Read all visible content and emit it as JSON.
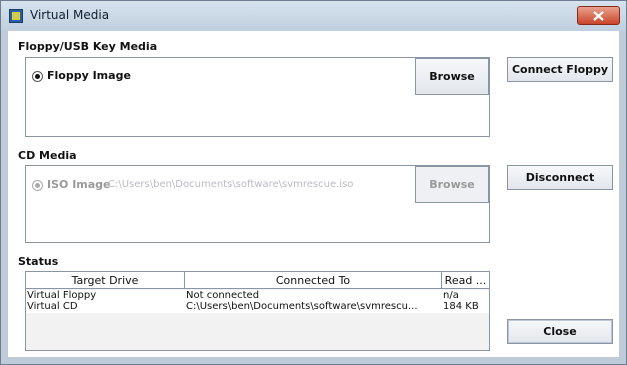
{
  "window": {
    "title": "Virtual Media"
  },
  "floppy": {
    "section_label": "Floppy/USB Key Media",
    "radio_label": "Floppy Image",
    "browse_label": "Browse",
    "connect_label": "Connect Floppy"
  },
  "cd": {
    "section_label": "CD Media",
    "radio_label": "ISO Image",
    "path": "C:\\Users\\ben\\Documents\\software\\svmrescue.iso",
    "browse_label": "Browse",
    "disconnect_label": "Disconnect"
  },
  "status": {
    "section_label": "Status",
    "columns": [
      "Target Drive",
      "Connected To",
      "Read ..."
    ],
    "rows": [
      [
        "Virtual Floppy",
        "Not connected",
        "n/a"
      ],
      [
        "Virtual CD",
        "C:\\Users\\ben\\Documents\\software\\svmrescu...",
        "184 KB"
      ]
    ]
  },
  "close_label": "Close",
  "icons": {
    "app": "virtual-media-app-icon",
    "close": "close-icon"
  },
  "colors": {
    "title_bar": "#c8d5e3",
    "close_button": "#c9452b",
    "disabled_text": "#999999"
  }
}
